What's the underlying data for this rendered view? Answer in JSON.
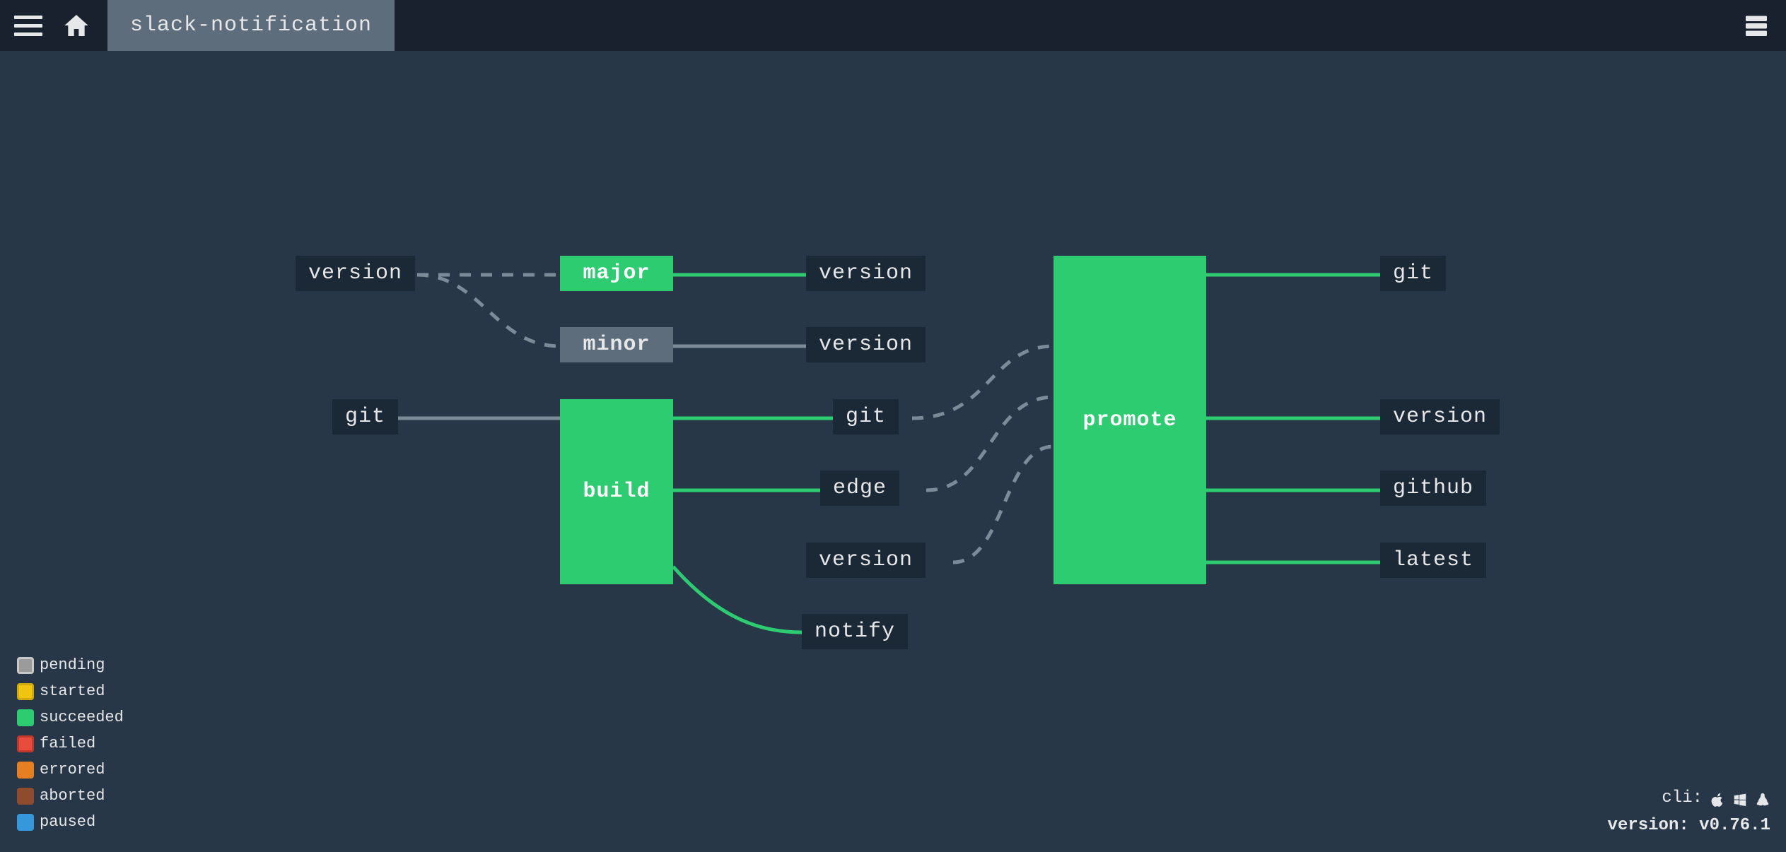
{
  "header": {
    "pipeline_title": "slack-notification"
  },
  "nodes": {
    "version_in": "version",
    "major": "major",
    "minor": "minor",
    "git_in": "git",
    "build": "build",
    "version_out1": "version",
    "version_out2": "version",
    "git_mid": "git",
    "edge": "edge",
    "version_out3": "version",
    "notify": "notify",
    "promote": "promote",
    "git_out": "git",
    "version_out4": "version",
    "github": "github",
    "latest": "latest"
  },
  "legend": {
    "pending": "pending",
    "started": "started",
    "succeeded": "succeeded",
    "failed": "failed",
    "errored": "errored",
    "aborted": "aborted",
    "paused": "paused"
  },
  "footer": {
    "cli_label": "cli:",
    "version_label": "version:",
    "version_value": "v0.76.1"
  },
  "colors": {
    "succeeded": "#2ecc71",
    "bg": "#273747",
    "node_dark": "#1b2936",
    "grey": "#5d6d7c"
  }
}
